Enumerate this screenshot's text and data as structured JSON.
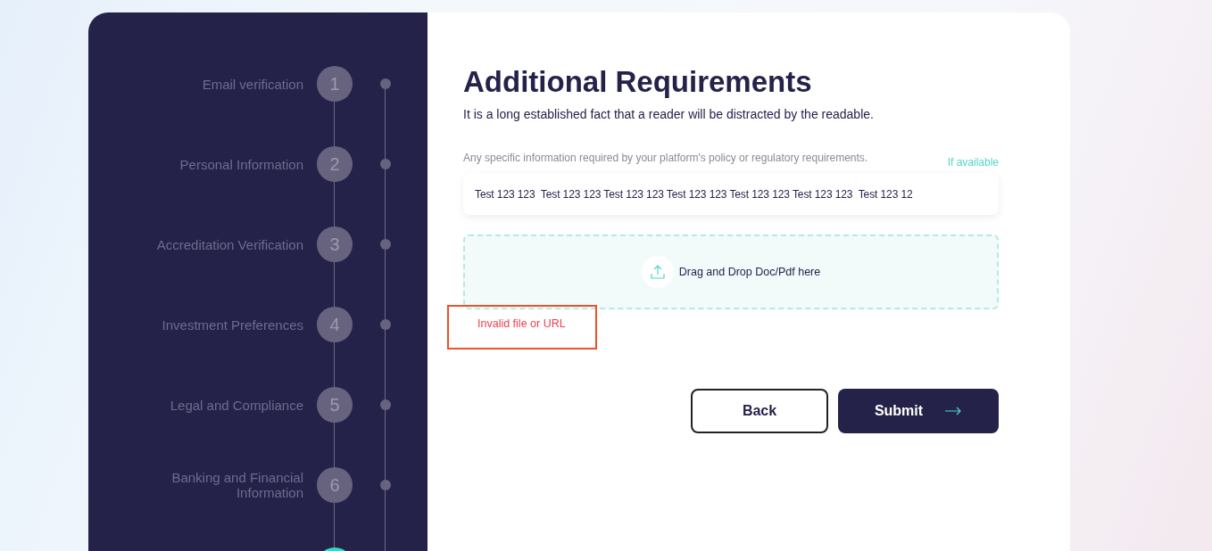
{
  "steps": [
    {
      "label": "Email verification",
      "number": "1",
      "selected": false
    },
    {
      "label": "Personal Information",
      "number": "2",
      "selected": false
    },
    {
      "label": "Accreditation Verification",
      "number": "3",
      "selected": false
    },
    {
      "label": "Investment Preferences",
      "number": "4",
      "selected": false
    },
    {
      "label": "Legal and Compliance",
      "number": "5",
      "selected": false
    },
    {
      "label": "Banking and Financial Information",
      "number": "6",
      "selected": false
    },
    {
      "selected": true
    }
  ],
  "title": "Additional Requirements",
  "subtitle": "It is a long established fact that a reader will be distracted by the readable.",
  "field": {
    "label": "Any specific information required by your platform's policy or regulatory requirements.",
    "hint": "If available",
    "value": "Test 123 123  Test 123 123 Test 123 123 Test 123 123 Test 123 123 Test 123 123  Test 123 12"
  },
  "dropzone": {
    "text": "Drag and Drop Doc/Pdf here"
  },
  "error": {
    "text": "Invalid file or URL",
    "highlighted": true
  },
  "buttons": [
    {
      "label": "Back",
      "kind": "secondary"
    },
    {
      "label": "Submit",
      "kind": "primary"
    }
  ]
}
